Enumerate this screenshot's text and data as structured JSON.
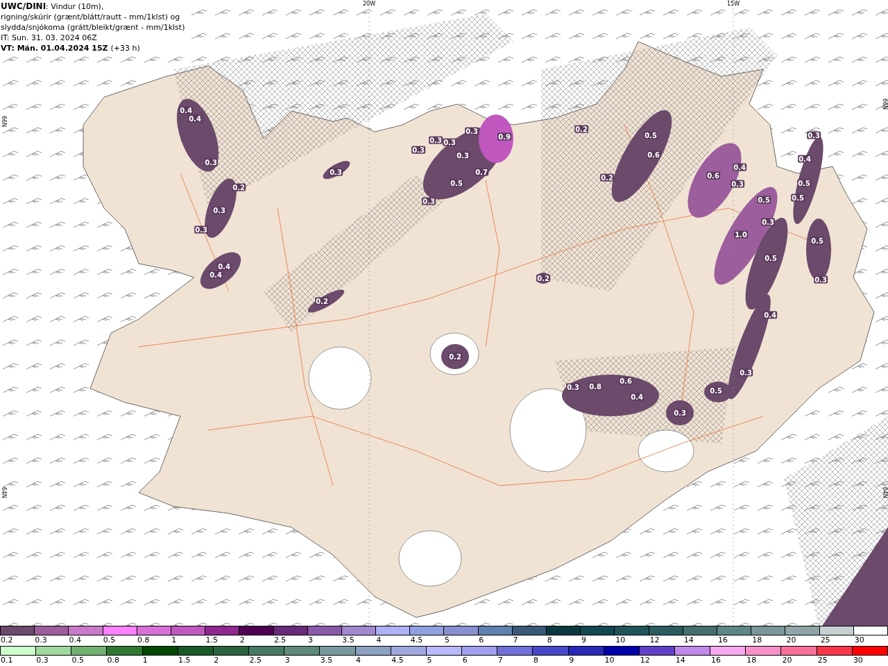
{
  "header": {
    "title": "UWC/DINI",
    "subtitle": ": Vindur (10m),",
    "lines": [
      "rigning/skúrir (grænt/blátt/rautt - mm/1klst) og",
      "slydda/snjókoma (grátt/bleikt/grænt - mm/1klst)",
      "IT: Sun. 31. 03. 2024 06Z"
    ],
    "valid_time": "VT: Mán. 01.04.2024 15Z",
    "offset": "(+33 h)"
  },
  "axis_labels": [
    "20W",
    "15W",
    "66N",
    "64N",
    "66N",
    "64N"
  ],
  "contour_labels": [
    "0.4",
    "0.4",
    "0.3",
    "0.2",
    "0.3",
    "0.3",
    "0.4",
    "0.4",
    "0.3",
    "0.2",
    "0.3",
    "0.3",
    "0.3",
    "0.3",
    "0.3",
    "0.9",
    "0.7",
    "0.5",
    "0.3",
    "0.2",
    "0.5",
    "0.6",
    "0.2",
    "0.6",
    "0.4",
    "0.3",
    "0.3",
    "0.4",
    "0.5",
    "0.5",
    "0.5",
    "0.3",
    "1.0",
    "0.5",
    "0.5",
    "0.3",
    "0.2",
    "0.4",
    "0.2",
    "0.3",
    "0.5",
    "0.3",
    "0.8",
    "0.6",
    "0.4",
    "0.3"
  ],
  "legend_snow": [
    {
      "label": "0.2",
      "color": "#6b4a6b"
    },
    {
      "label": "0.3",
      "color": "#9c5e9c"
    },
    {
      "label": "0.4",
      "color": "#c87ac8"
    },
    {
      "label": "0.5",
      "color": "#ff80ff"
    },
    {
      "label": "0.8",
      "color": "#d870d8"
    },
    {
      "label": "1",
      "color": "#c058c0"
    },
    {
      "label": "1.5",
      "color": "#902890"
    },
    {
      "label": "2",
      "color": "#500050"
    },
    {
      "label": "2.5",
      "color": "#6a2a7a"
    },
    {
      "label": "3",
      "color": "#8a5aaa"
    },
    {
      "label": "3.5",
      "color": "#9f88d0"
    },
    {
      "label": "4",
      "color": "#b0b0f8"
    },
    {
      "label": "4.5",
      "color": "#90a0e0"
    },
    {
      "label": "5",
      "color": "#8890d0"
    },
    {
      "label": "6",
      "color": "#6080b0"
    },
    {
      "label": "7",
      "color": "#3a5878"
    },
    {
      "label": "8",
      "color": "#0a3a40"
    },
    {
      "label": "9",
      "color": "#104850"
    },
    {
      "label": "10",
      "color": "#205458"
    },
    {
      "label": "12",
      "color": "#2a5c60"
    },
    {
      "label": "14",
      "color": "#446e70"
    },
    {
      "label": "16",
      "color": "#5e8688"
    },
    {
      "label": "18",
      "color": "#7a9698"
    },
    {
      "label": "20",
      "color": "#8ea4a6"
    },
    {
      "label": "25",
      "color": "#c6d0d2"
    },
    {
      "label": "30",
      "color": "#ffffff"
    }
  ],
  "legend_rain": [
    {
      "label": "0.1",
      "color": "#ccffcc"
    },
    {
      "label": "0.3",
      "color": "#a0d8a0"
    },
    {
      "label": "0.5",
      "color": "#70b070"
    },
    {
      "label": "0.8",
      "color": "#307830"
    },
    {
      "label": "1",
      "color": "#004800"
    },
    {
      "label": "1.5",
      "color": "#1a5a2a"
    },
    {
      "label": "2",
      "color": "#2a6440"
    },
    {
      "label": "2.5",
      "color": "#467a64"
    },
    {
      "label": "3",
      "color": "#5e8a7a"
    },
    {
      "label": "3.5",
      "color": "#7a98a0"
    },
    {
      "label": "4",
      "color": "#8ca0c0"
    },
    {
      "label": "4.5",
      "color": "#a0a8e0"
    },
    {
      "label": "5",
      "color": "#b8b8ff"
    },
    {
      "label": "6",
      "color": "#a0a0ee"
    },
    {
      "label": "7",
      "color": "#7070d8"
    },
    {
      "label": "8",
      "color": "#4848c8"
    },
    {
      "label": "9",
      "color": "#2828b8"
    },
    {
      "label": "10",
      "color": "#0000a8"
    },
    {
      "label": "12",
      "color": "#6040c8"
    },
    {
      "label": "14",
      "color": "#c088e8"
    },
    {
      "label": "16",
      "color": "#f8a8f0"
    },
    {
      "label": "18",
      "color": "#f890c8"
    },
    {
      "label": "20",
      "color": "#f87098"
    },
    {
      "label": "25",
      "color": "#f83848"
    },
    {
      "label": "30",
      "color": "#ff0000"
    }
  ]
}
